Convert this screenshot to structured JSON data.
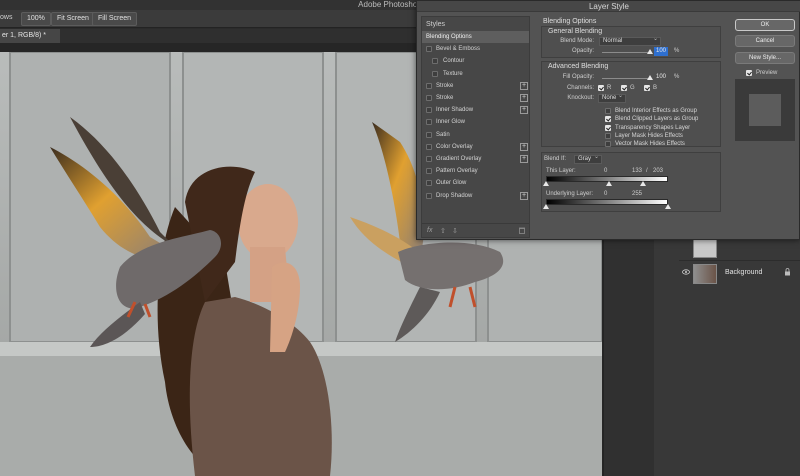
{
  "app": {
    "title": "Adobe Photoshop 2022",
    "options": {
      "windows_label": "ows",
      "zoom": "100%",
      "fit_screen": "Fit Screen",
      "fill_screen": "Fill Screen"
    },
    "doc_tab": "er 1, RGB/8) *"
  },
  "layers_panel": {
    "background_name": "Background"
  },
  "dialog": {
    "title": "Layer Style",
    "styles_header": "Styles",
    "styles": [
      {
        "label": "Blending Options",
        "checkbox": false,
        "plus": false,
        "active": true
      },
      {
        "label": "Bevel & Emboss",
        "checkbox": true,
        "plus": false
      },
      {
        "label": "Contour",
        "checkbox": true,
        "plus": false,
        "indent": true
      },
      {
        "label": "Texture",
        "checkbox": true,
        "plus": false,
        "indent": true
      },
      {
        "label": "Stroke",
        "checkbox": true,
        "plus": true
      },
      {
        "label": "Stroke",
        "checkbox": true,
        "plus": true
      },
      {
        "label": "Inner Shadow",
        "checkbox": true,
        "plus": true
      },
      {
        "label": "Inner Glow",
        "checkbox": true,
        "plus": false
      },
      {
        "label": "Satin",
        "checkbox": true,
        "plus": false
      },
      {
        "label": "Color Overlay",
        "checkbox": true,
        "plus": true
      },
      {
        "label": "Gradient Overlay",
        "checkbox": true,
        "plus": true
      },
      {
        "label": "Pattern Overlay",
        "checkbox": true,
        "plus": false
      },
      {
        "label": "Outer Glow",
        "checkbox": true,
        "plus": false
      },
      {
        "label": "Drop Shadow",
        "checkbox": true,
        "plus": true
      }
    ],
    "footer_icons": [
      "fx",
      "⇧",
      "⇩"
    ],
    "blending": {
      "heading": "Blending Options",
      "general_heading": "General Blending",
      "blend_mode_label": "Blend Mode:",
      "blend_mode_value": "Normal",
      "opacity_label": "Opacity:",
      "opacity_value": "100",
      "percent": "%",
      "advanced_heading": "Advanced Blending",
      "fill_opacity_label": "Fill Opacity:",
      "fill_opacity_value": "100",
      "channels_label": "Channels:",
      "channel_r": "R",
      "channel_g": "G",
      "channel_b": "B",
      "knockout_label": "Knockout:",
      "knockout_value": "None",
      "options": [
        {
          "label": "Blend Interior Effects as Group",
          "checked": false
        },
        {
          "label": "Blend Clipped Layers as Group",
          "checked": true
        },
        {
          "label": "Transparency Shapes Layer",
          "checked": true
        },
        {
          "label": "Layer Mask Hides Effects",
          "checked": false
        },
        {
          "label": "Vector Mask Hides Effects",
          "checked": false
        }
      ],
      "blend_if_label": "Blend If:",
      "blend_if_value": "Gray",
      "this_layer_label": "This Layer:",
      "this_layer_low": "0",
      "this_layer_high_a": "133",
      "this_layer_slash": "/",
      "this_layer_high_b": "203",
      "underlying_label": "Underlying Layer:",
      "underlying_low": "0",
      "underlying_high": "255"
    },
    "buttons": {
      "ok": "OK",
      "cancel": "Cancel",
      "new_style": "New Style...",
      "preview": "Preview"
    },
    "preview_checked": true
  }
}
